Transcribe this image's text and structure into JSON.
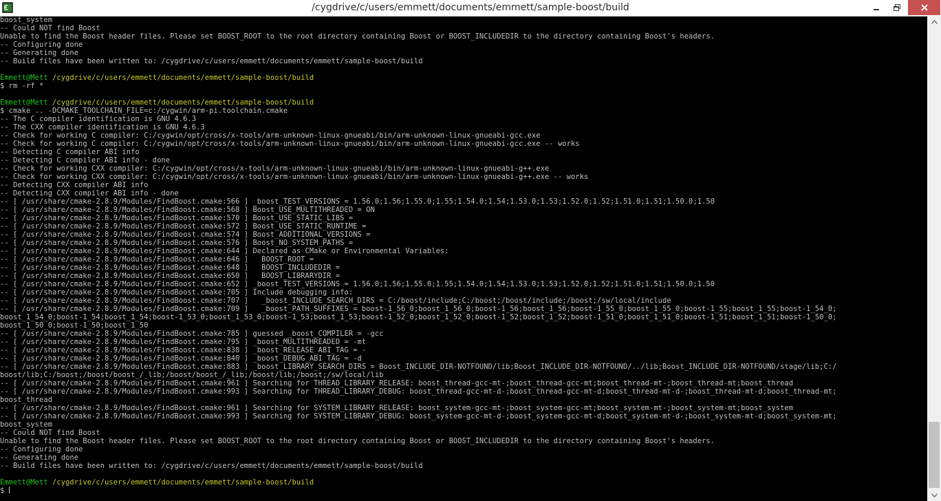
{
  "window": {
    "title": "/cygdrive/c/users/emmett/documents/emmett/sample-boost/build",
    "buttons": {
      "minimize": "minimize",
      "maximize": "restore",
      "close": "close"
    },
    "colors": {
      "titlebar_bg": "#ffffff",
      "close_bg": "#c75050",
      "terminal_bg": "#000000",
      "text": "#c0c0c0",
      "user": "#24c024",
      "path": "#c9c930"
    }
  },
  "scrollbar": {
    "position_fraction": 0.88
  },
  "terminal": {
    "lines": [
      {
        "kind": "text",
        "text": "boost_system"
      },
      {
        "kind": "text",
        "text": "-- Could NOT find Boost"
      },
      {
        "kind": "text",
        "text": "Unable to find the Boost header files. Please set BOOST_ROOT to the root directory containing Boost or BOOST_INCLUDEDIR to the directory containing Boost's headers."
      },
      {
        "kind": "text",
        "text": "-- Configuring done"
      },
      {
        "kind": "text",
        "text": "-- Generating done"
      },
      {
        "kind": "text",
        "text": "-- Build files have been written to: /cygdrive/c/users/emmett/documents/emmett/sample-boost/build"
      },
      {
        "kind": "text",
        "text": ""
      },
      {
        "kind": "prompt",
        "user": "Emmett@Mett",
        "path": "/cygdrive/c/users/emmett/documents/emmett/sample-boost/build"
      },
      {
        "kind": "text",
        "text": "$ rm -rf *"
      },
      {
        "kind": "text",
        "text": ""
      },
      {
        "kind": "prompt",
        "user": "Emmett@Mett",
        "path": "/cygdrive/c/users/emmett/documents/emmett/sample-boost/build"
      },
      {
        "kind": "text",
        "text": "$ cmake .. -DCMAKE_TOOLCHAIN_FILE=c:/cygwin/arm-pi.toolchain.cmake"
      },
      {
        "kind": "text",
        "text": "-- The C compiler identification is GNU 4.6.3"
      },
      {
        "kind": "text",
        "text": "-- The CXX compiler identification is GNU 4.6.3"
      },
      {
        "kind": "text",
        "text": "-- Check for working C compiler: C:/cygwin/opt/cross/x-tools/arm-unknown-linux-gnueabi/bin/arm-unknown-linux-gnueabi-gcc.exe"
      },
      {
        "kind": "text",
        "text": "-- Check for working C compiler: C:/cygwin/opt/cross/x-tools/arm-unknown-linux-gnueabi/bin/arm-unknown-linux-gnueabi-gcc.exe -- works"
      },
      {
        "kind": "text",
        "text": "-- Detecting C compiler ABI info"
      },
      {
        "kind": "text",
        "text": "-- Detecting C compiler ABI info - done"
      },
      {
        "kind": "text",
        "text": "-- Check for working CXX compiler: C:/cygwin/opt/cross/x-tools/arm-unknown-linux-gnueabi/bin/arm-unknown-linux-gnueabi-g++.exe"
      },
      {
        "kind": "text",
        "text": "-- Check for working CXX compiler: C:/cygwin/opt/cross/x-tools/arm-unknown-linux-gnueabi/bin/arm-unknown-linux-gnueabi-g++.exe -- works"
      },
      {
        "kind": "text",
        "text": "-- Detecting CXX compiler ABI info"
      },
      {
        "kind": "text",
        "text": "-- Detecting CXX compiler ABI info - done"
      },
      {
        "kind": "text",
        "text": "-- [ /usr/share/cmake-2.8.9/Modules/FindBoost.cmake:566 ] _boost_TEST_VERSIONS = 1.56.0;1.56;1.55.0;1.55;1.54.0;1.54;1.53.0;1.53;1.52.0;1.52;1.51.0;1.51;1.50.0;1.50"
      },
      {
        "kind": "text",
        "text": "-- [ /usr/share/cmake-2.8.9/Modules/FindBoost.cmake:568 ] Boost_USE_MULTITHREADED = ON"
      },
      {
        "kind": "text",
        "text": "-- [ /usr/share/cmake-2.8.9/Modules/FindBoost.cmake:570 ] Boost_USE_STATIC_LIBS ="
      },
      {
        "kind": "text",
        "text": "-- [ /usr/share/cmake-2.8.9/Modules/FindBoost.cmake:572 ] Boost_USE_STATIC_RUNTIME ="
      },
      {
        "kind": "text",
        "text": "-- [ /usr/share/cmake-2.8.9/Modules/FindBoost.cmake:574 ] Boost_ADDITIONAL_VERSIONS ="
      },
      {
        "kind": "text",
        "text": "-- [ /usr/share/cmake-2.8.9/Modules/FindBoost.cmake:576 ] Boost_NO_SYSTEM_PATHS ="
      },
      {
        "kind": "text",
        "text": "-- [ /usr/share/cmake-2.8.9/Modules/FindBoost.cmake:644 ] Declared as CMake or Environmental Variables:"
      },
      {
        "kind": "text",
        "text": "-- [ /usr/share/cmake-2.8.9/Modules/FindBoost.cmake:646 ]   BOOST_ROOT ="
      },
      {
        "kind": "text",
        "text": "-- [ /usr/share/cmake-2.8.9/Modules/FindBoost.cmake:648 ]   BOOST_INCLUDEDIR ="
      },
      {
        "kind": "text",
        "text": "-- [ /usr/share/cmake-2.8.9/Modules/FindBoost.cmake:650 ]   BOOST_LIBRARYDIR ="
      },
      {
        "kind": "text",
        "text": "-- [ /usr/share/cmake-2.8.9/Modules/FindBoost.cmake:652 ] _boost_TEST_VERSIONS = 1.56.0;1.56;1.55.0;1.55;1.54.0;1.54;1.53.0;1.53;1.52.0;1.52;1.51.0;1.51;1.50.0;1.50"
      },
      {
        "kind": "text",
        "text": "-- [ /usr/share/cmake-2.8.9/Modules/FindBoost.cmake:705 ] Include debugging info:"
      },
      {
        "kind": "text",
        "text": "-- [ /usr/share/cmake-2.8.9/Modules/FindBoost.cmake:707 ]   _boost_INCLUDE_SEARCH_DIRS = C:/boost/include;C:/boost;/boost/include;/boost;/sw/local/include"
      },
      {
        "kind": "text",
        "text": "-- [ /usr/share/cmake-2.8.9/Modules/FindBoost.cmake:709 ]   _boost_PATH_SUFFIXES = boost-1_56_0;boost_1_56_0;boost-1_56;boost_1_56;boost-1_55_0;boost_1_55_0;boost-1_55;boost_1_55;boost-1_54_0;"
      },
      {
        "kind": "text",
        "text": "boost_1_54_0;boost-1_54;boost_1_54;boost-1_53_0;boost_1_53_0;boost-1_53;boost_1_53;boost-1_52_0;boost_1_52_0;boost-1_52;boost_1_52;boost-1_51_0;boost_1_51_0;boost-1_51;boost_1_51;boost-1_50_0;"
      },
      {
        "kind": "text",
        "text": "boost_1_50_0;boost-1_50;boost_1_50"
      },
      {
        "kind": "text",
        "text": "-- [ /usr/share/cmake-2.8.9/Modules/FindBoost.cmake:785 ] guessed _boost_COMPILER = -gcc"
      },
      {
        "kind": "text",
        "text": "-- [ /usr/share/cmake-2.8.9/Modules/FindBoost.cmake:795 ] _boost_MULTITHREADED = -mt"
      },
      {
        "kind": "text",
        "text": "-- [ /usr/share/cmake-2.8.9/Modules/FindBoost.cmake:838 ] _boost_RELEASE_ABI_TAG = -"
      },
      {
        "kind": "text",
        "text": "-- [ /usr/share/cmake-2.8.9/Modules/FindBoost.cmake:840 ] _boost_DEBUG_ABI_TAG = -d"
      },
      {
        "kind": "text",
        "text": "-- [ /usr/share/cmake-2.8.9/Modules/FindBoost.cmake:883 ] _boost_LIBRARY_SEARCH_DIRS = Boost_INCLUDE_DIR-NOTFOUND/lib;Boost_INCLUDE_DIR-NOTFOUND/../lib;Boost_INCLUDE_DIR-NOTFOUND/stage/lib;C:/"
      },
      {
        "kind": "text",
        "text": "boost/lib;C:/boost;/boost/boost_/_lib;/boost/boost_/_lib;/boost/lib;/boost;/sw/local/lib"
      },
      {
        "kind": "text",
        "text": "-- [ /usr/share/cmake-2.8.9/Modules/FindBoost.cmake:961 ] Searching for THREAD_LIBRARY_RELEASE: boost_thread-gcc-mt-;boost_thread-gcc-mt;boost_thread-mt-;boost_thread-mt;boost_thread"
      },
      {
        "kind": "text",
        "text": "-- [ /usr/share/cmake-2.8.9/Modules/FindBoost.cmake:993 ] Searching for THREAD_LIBRARY_DEBUG: boost_thread-gcc-mt-d-;boost_thread-gcc-mt-d;boost_thread-mt-d-;boost_thread-mt-d;boost_thread-mt;"
      },
      {
        "kind": "text",
        "text": "boost_thread"
      },
      {
        "kind": "text",
        "text": "-- [ /usr/share/cmake-2.8.9/Modules/FindBoost.cmake:961 ] Searching for SYSTEM_LIBRARY_RELEASE: boost_system-gcc-mt-;boost_system-gcc-mt;boost_system-mt-;boost_system-mt;boost_system"
      },
      {
        "kind": "text",
        "text": "-- [ /usr/share/cmake-2.8.9/Modules/FindBoost.cmake:993 ] Searching for SYSTEM_LIBRARY_DEBUG: boost_system-gcc-mt-d-;boost_system-gcc-mt-d;boost_system-mt-d-;boost_system-mt-d;boost_system-mt;"
      },
      {
        "kind": "text",
        "text": "boost_system"
      },
      {
        "kind": "text",
        "text": "-- Could NOT find Boost"
      },
      {
        "kind": "text",
        "text": "Unable to find the Boost header files. Please set BOOST_ROOT to the root directory containing Boost or BOOST_INCLUDEDIR to the directory containing Boost's headers."
      },
      {
        "kind": "text",
        "text": "-- Configuring done"
      },
      {
        "kind": "text",
        "text": "-- Generating done"
      },
      {
        "kind": "text",
        "text": "-- Build files have been written to: /cygdrive/c/users/emmett/documents/emmett/sample-boost/build"
      },
      {
        "kind": "text",
        "text": ""
      },
      {
        "kind": "prompt",
        "user": "Emmett@Mett",
        "path": "/cygdrive/c/users/emmett/documents/emmett/sample-boost/build"
      },
      {
        "kind": "input",
        "text": "$ "
      }
    ]
  }
}
